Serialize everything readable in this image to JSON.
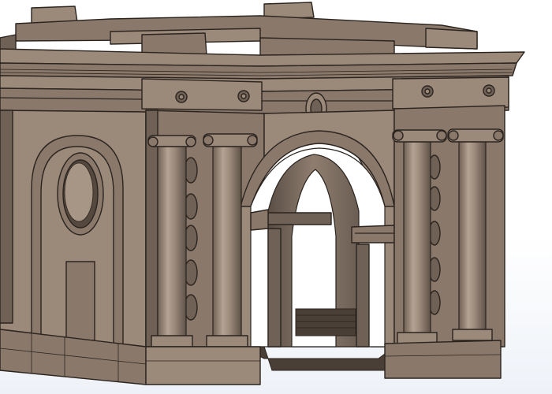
{
  "scene": {
    "subject": "triumphal-arch-cad-model",
    "colors": {
      "background": "#ffffff",
      "stone": "#8a796b",
      "stone_light": "#9b897a",
      "stone_dark": "#6f6155",
      "edge": "#2b241f"
    },
    "icons": [
      "rosette-icon",
      "medallion-icon",
      "ionic-capital-icon"
    ]
  }
}
